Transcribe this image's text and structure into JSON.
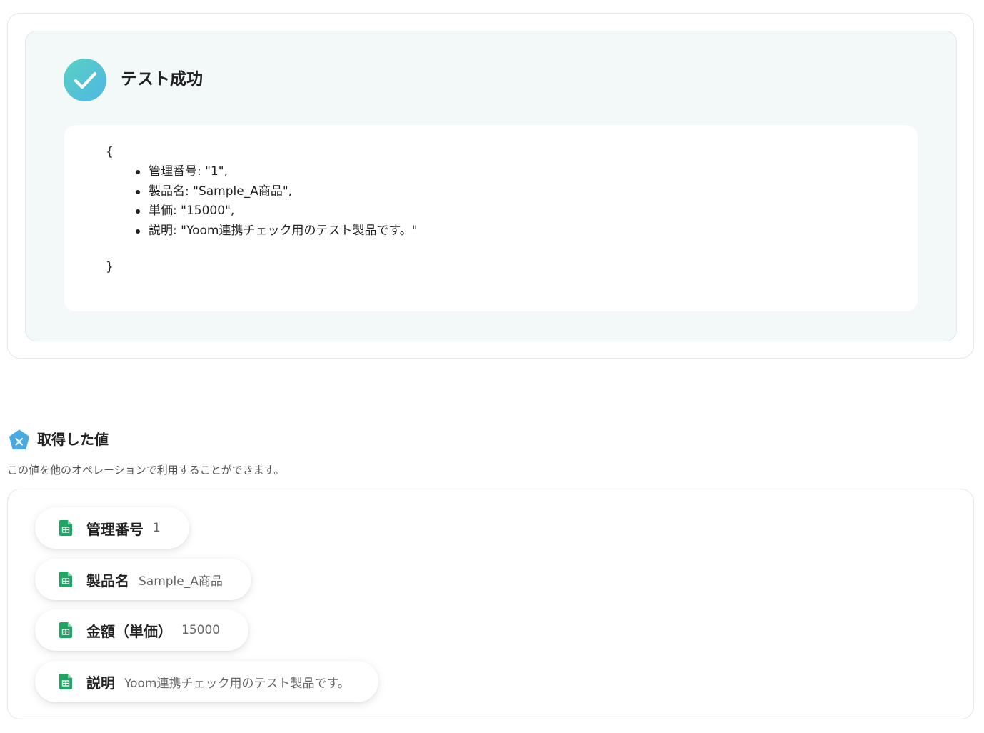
{
  "result": {
    "title": "テスト成功",
    "open_brace": "{",
    "close_brace": "}",
    "items": [
      "管理番号: \"1\",",
      "製品名: \"Sample_A商品\",",
      "単価: \"15000\",",
      "説明: \"Yoom連携チェック用のテスト製品です。\""
    ]
  },
  "values_section": {
    "title": "取得した値",
    "description": "この値を他のオペレーションで利用することができます。",
    "icon": "variable-x-icon",
    "chips": [
      {
        "label": "管理番号",
        "value": "1",
        "icon": "google-sheets-icon"
      },
      {
        "label": "製品名",
        "value": "Sample_A商品",
        "icon": "google-sheets-icon"
      },
      {
        "label": "金額（単価）",
        "value": "15000",
        "icon": "google-sheets-icon"
      },
      {
        "label": "説明",
        "value": "Yoom連携チェック用のテスト製品です。",
        "icon": "google-sheets-icon"
      }
    ]
  },
  "colors": {
    "success_gradient_start": "#59d1c0",
    "success_gradient_end": "#4fb7e6",
    "sheets_green": "#1fa463",
    "variable_blue": "#4aa9e0"
  }
}
